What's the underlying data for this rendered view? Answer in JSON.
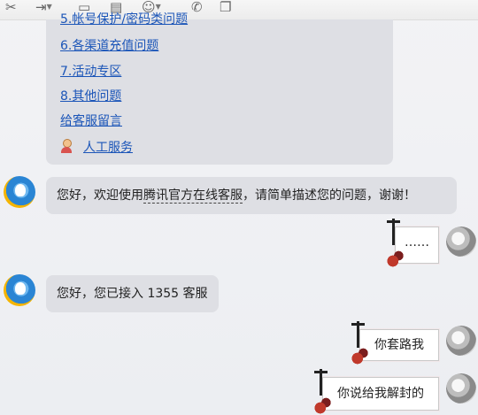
{
  "toolbar": {
    "icons": [
      "scissors-icon",
      "export-icon",
      "screen-icon",
      "document-icon",
      "emoji-icon",
      "phone-icon",
      "copy-icon"
    ]
  },
  "menu": {
    "partial_item": "5.帐号保护/密码类问题",
    "items": [
      "6.各渠道充值问题",
      "7.活动专区",
      "8.其他问题",
      "给客服留言"
    ],
    "human_service": "人工服务"
  },
  "messages": {
    "welcome_prefix": "您好，欢迎使用",
    "welcome_link": "腾讯官方在线客服",
    "welcome_suffix": "，请简单描述您的问题，谢谢！",
    "user_sticker1": "……",
    "connected": "您好，您已接入 1355 客服",
    "user_msg2": "你套路我",
    "user_msg3": "你说给我解封的"
  }
}
